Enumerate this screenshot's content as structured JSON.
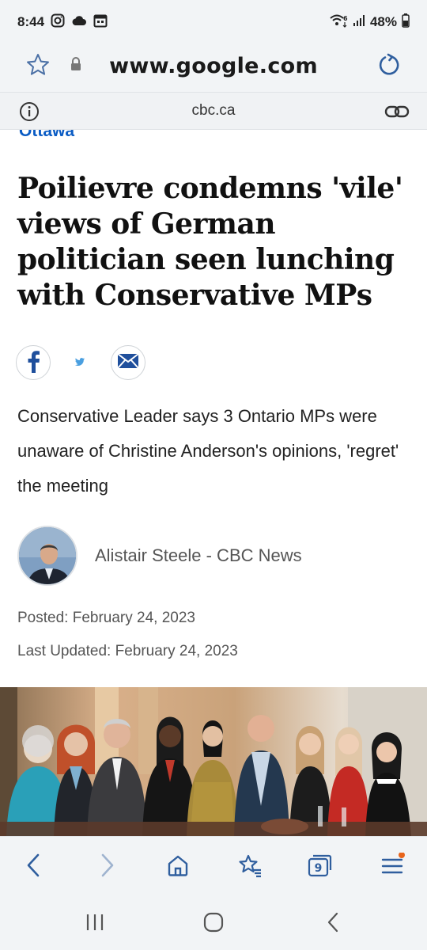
{
  "status_bar": {
    "time": "8:44",
    "battery": "48%",
    "left_icons": [
      "instagram-icon",
      "cloud-icon",
      "calendar-icon"
    ],
    "right_icons": [
      "wifi-6-icon",
      "signal-icon",
      "battery-icon"
    ]
  },
  "url_bar": {
    "url": "www.google.com",
    "icons": [
      "star-icon",
      "lock-icon",
      "reload-icon"
    ]
  },
  "site_bar": {
    "domain": "cbc.ca",
    "icons": [
      "info-icon",
      "link-icon"
    ]
  },
  "article": {
    "section": "Ottawa",
    "headline": "Poilievre condemns 'vile' views of German politician seen lunching with Conservative MPs",
    "share_icons": [
      "facebook-icon",
      "twitter-icon",
      "email-icon"
    ],
    "deck": "Conservative Leader says 3 Ontario MPs were unaware of Christine Anderson's opinions, 'regret' the meeting",
    "author": "Alistair Steele - CBC News",
    "posted": "Posted: February 24, 2023",
    "updated": "Last Updated: February 24, 2023"
  },
  "toolbar": {
    "tab_count": "9",
    "icons": [
      "back-icon",
      "forward-icon",
      "home-icon",
      "bookmarks-icon",
      "tabs-icon",
      "menu-icon"
    ],
    "colors": {
      "notification_dot": "#e8641b"
    }
  },
  "nav_bar": {
    "icons": [
      "recents-icon",
      "home-circle-icon",
      "back-chevron-icon"
    ]
  },
  "colors": {
    "section_label": "#0b5cc4",
    "chrome_bg": "#f2f4f6",
    "facebook_blue": "#1f4f9c"
  }
}
